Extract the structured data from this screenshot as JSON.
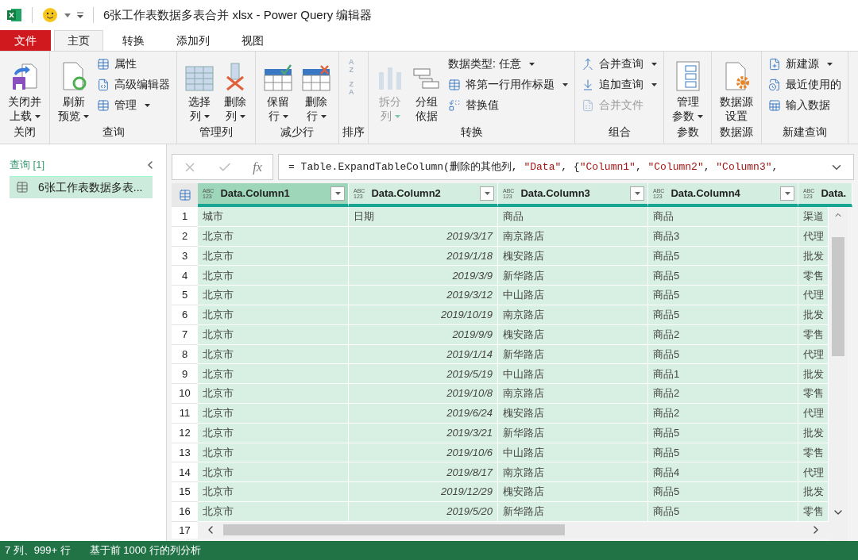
{
  "window": {
    "title": "6张工作表数据多表合并 xlsx - Power Query 编辑器"
  },
  "ribbon_tabs": [
    {
      "label": "文件",
      "kind": "file",
      "selected": false
    },
    {
      "label": "主页",
      "kind": "tab",
      "selected": true
    },
    {
      "label": "转换",
      "kind": "tab",
      "selected": false
    },
    {
      "label": "添加列",
      "kind": "tab",
      "selected": false
    },
    {
      "label": "视图",
      "kind": "tab",
      "selected": false
    }
  ],
  "ribbon_groups": [
    {
      "label": "关闭",
      "columns": [
        {
          "kind": "large",
          "lines": [
            "关闭并",
            "上载"
          ],
          "dropdown": true,
          "disabled": false
        }
      ]
    },
    {
      "label": "查询",
      "columns": [
        {
          "kind": "large",
          "lines": [
            "刷新",
            "预览"
          ],
          "dropdown": true,
          "disabled": false
        },
        {
          "kind": "stack",
          "items": [
            {
              "label": "属性",
              "dropdown": false,
              "disabled": false
            },
            {
              "label": "高级编辑器",
              "dropdown": false,
              "disabled": false
            },
            {
              "label": "管理",
              "dropdown": true,
              "disabled": false
            }
          ]
        }
      ]
    },
    {
      "label": "管理列",
      "columns": [
        {
          "kind": "large",
          "lines": [
            "选择",
            "列"
          ],
          "dropdown": true,
          "disabled": false
        },
        {
          "kind": "large",
          "lines": [
            "删除",
            "列"
          ],
          "dropdown": true,
          "disabled": false
        }
      ]
    },
    {
      "label": "减少行",
      "columns": [
        {
          "kind": "large",
          "lines": [
            "保留",
            "行"
          ],
          "dropdown": true,
          "disabled": false
        },
        {
          "kind": "large",
          "lines": [
            "删除",
            "行"
          ],
          "dropdown": true,
          "disabled": false
        }
      ]
    },
    {
      "label": "排序",
      "columns": [
        {
          "kind": "sort",
          "items": [
            {
              "glyph": [
                "A",
                "Z"
              ]
            },
            {
              "glyph": [
                "Z",
                "A"
              ]
            }
          ]
        }
      ]
    },
    {
      "label": "转换",
      "columns": [
        {
          "kind": "large",
          "lines": [
            "拆分",
            "列"
          ],
          "dropdown": true,
          "disabled": true
        },
        {
          "kind": "large",
          "lines": [
            "分组",
            "依据"
          ],
          "dropdown": false,
          "disabled": false
        },
        {
          "kind": "stack",
          "items": [
            {
              "label": "数据类型: 任意",
              "dropdown": true,
              "disabled": false
            },
            {
              "label": "将第一行用作标题",
              "dropdown": true,
              "disabled": false
            },
            {
              "label": "替换值",
              "dropdown": false,
              "disabled": false
            }
          ]
        }
      ]
    },
    {
      "label": "组合",
      "columns": [
        {
          "kind": "stack",
          "items": [
            {
              "label": "合并查询",
              "dropdown": true,
              "disabled": false
            },
            {
              "label": "追加查询",
              "dropdown": true,
              "disabled": false
            },
            {
              "label": "合并文件",
              "dropdown": false,
              "disabled": true
            }
          ]
        }
      ]
    },
    {
      "label": "参数",
      "columns": [
        {
          "kind": "large",
          "lines": [
            "管理",
            "参数"
          ],
          "dropdown": true,
          "disabled": false
        }
      ]
    },
    {
      "label": "数据源",
      "columns": [
        {
          "kind": "large",
          "lines": [
            "数据源",
            "设置"
          ],
          "dropdown": false,
          "disabled": false
        }
      ]
    },
    {
      "label": "新建查询",
      "columns": [
        {
          "kind": "stack",
          "items": [
            {
              "label": "新建源",
              "dropdown": true,
              "disabled": false
            },
            {
              "label": "最近使用的",
              "dropdown": false,
              "disabled": false
            },
            {
              "label": "输入数据",
              "dropdown": false,
              "disabled": false
            }
          ]
        }
      ]
    }
  ],
  "queries_pane": {
    "header": "查询 [1]",
    "items": [
      {
        "label": "6张工作表数据多表...",
        "selected": true
      }
    ]
  },
  "formula_bar": {
    "fx": "fx",
    "segments": [
      {
        "kind": "code",
        "text": "= Table.ExpandTableColumn(删除的其他列, "
      },
      {
        "kind": "string",
        "text": "\"Data\""
      },
      {
        "kind": "code",
        "text": ", {"
      },
      {
        "kind": "string",
        "text": "\"Column1\""
      },
      {
        "kind": "code",
        "text": ", "
      },
      {
        "kind": "string",
        "text": "\"Column2\""
      },
      {
        "kind": "code",
        "text": ", "
      },
      {
        "kind": "string",
        "text": "\"Column3\""
      },
      {
        "kind": "code",
        "text": ","
      }
    ]
  },
  "table": {
    "columns": [
      {
        "name": "Data.Column1",
        "type": [
          "ABC",
          "123"
        ],
        "kind": "text",
        "selected": true
      },
      {
        "name": "Data.Column2",
        "type": [
          "ABC",
          "123"
        ],
        "kind": "date",
        "selected": false
      },
      {
        "name": "Data.Column3",
        "type": [
          "ABC",
          "123"
        ],
        "kind": "text",
        "selected": false
      },
      {
        "name": "Data.Column4",
        "type": [
          "ABC",
          "123"
        ],
        "kind": "text",
        "selected": false
      },
      {
        "name": "Data.",
        "type": [
          "ABC",
          "123"
        ],
        "kind": "text",
        "selected": false
      }
    ],
    "rows": [
      {
        "number": "1",
        "kind": "text",
        "cells": [
          "城市",
          "日期",
          "商品",
          "商品",
          "渠道"
        ]
      },
      {
        "number": "2",
        "kind": "values",
        "cells": [
          "北京市",
          "2019/3/17",
          "南京路店",
          "商品3",
          "代理"
        ]
      },
      {
        "number": "3",
        "kind": "values",
        "cells": [
          "北京市",
          "2019/1/18",
          "槐安路店",
          "商品5",
          "批发"
        ]
      },
      {
        "number": "4",
        "kind": "values",
        "cells": [
          "北京市",
          "2019/3/9",
          "新华路店",
          "商品5",
          "零售"
        ]
      },
      {
        "number": "5",
        "kind": "values",
        "cells": [
          "北京市",
          "2019/3/12",
          "中山路店",
          "商品5",
          "代理"
        ]
      },
      {
        "number": "6",
        "kind": "values",
        "cells": [
          "北京市",
          "2019/10/19",
          "南京路店",
          "商品5",
          "批发"
        ]
      },
      {
        "number": "7",
        "kind": "values",
        "cells": [
          "北京市",
          "2019/9/9",
          "槐安路店",
          "商品2",
          "零售"
        ]
      },
      {
        "number": "8",
        "kind": "values",
        "cells": [
          "北京市",
          "2019/1/14",
          "新华路店",
          "商品5",
          "代理"
        ]
      },
      {
        "number": "9",
        "kind": "values",
        "cells": [
          "北京市",
          "2019/5/19",
          "中山路店",
          "商品1",
          "批发"
        ]
      },
      {
        "number": "10",
        "kind": "values",
        "cells": [
          "北京市",
          "2019/10/8",
          "南京路店",
          "商品2",
          "零售"
        ]
      },
      {
        "number": "11",
        "kind": "values",
        "cells": [
          "北京市",
          "2019/6/24",
          "槐安路店",
          "商品2",
          "代理"
        ]
      },
      {
        "number": "12",
        "kind": "values",
        "cells": [
          "北京市",
          "2019/3/21",
          "新华路店",
          "商品5",
          "批发"
        ]
      },
      {
        "number": "13",
        "kind": "values",
        "cells": [
          "北京市",
          "2019/10/6",
          "中山路店",
          "商品5",
          "零售"
        ]
      },
      {
        "number": "14",
        "kind": "values",
        "cells": [
          "北京市",
          "2019/8/17",
          "南京路店",
          "商品4",
          "代理"
        ]
      },
      {
        "number": "15",
        "kind": "values",
        "cells": [
          "北京市",
          "2019/12/29",
          "槐安路店",
          "商品5",
          "批发"
        ]
      },
      {
        "number": "16",
        "kind": "values",
        "cells": [
          "北京市",
          "2019/5/20",
          "新华路店",
          "商品5",
          "零售"
        ]
      }
    ],
    "partial_row_number": "17"
  },
  "status_bar": [
    "7 列、999+ 行",
    "基于前 1000 行的列分析"
  ]
}
